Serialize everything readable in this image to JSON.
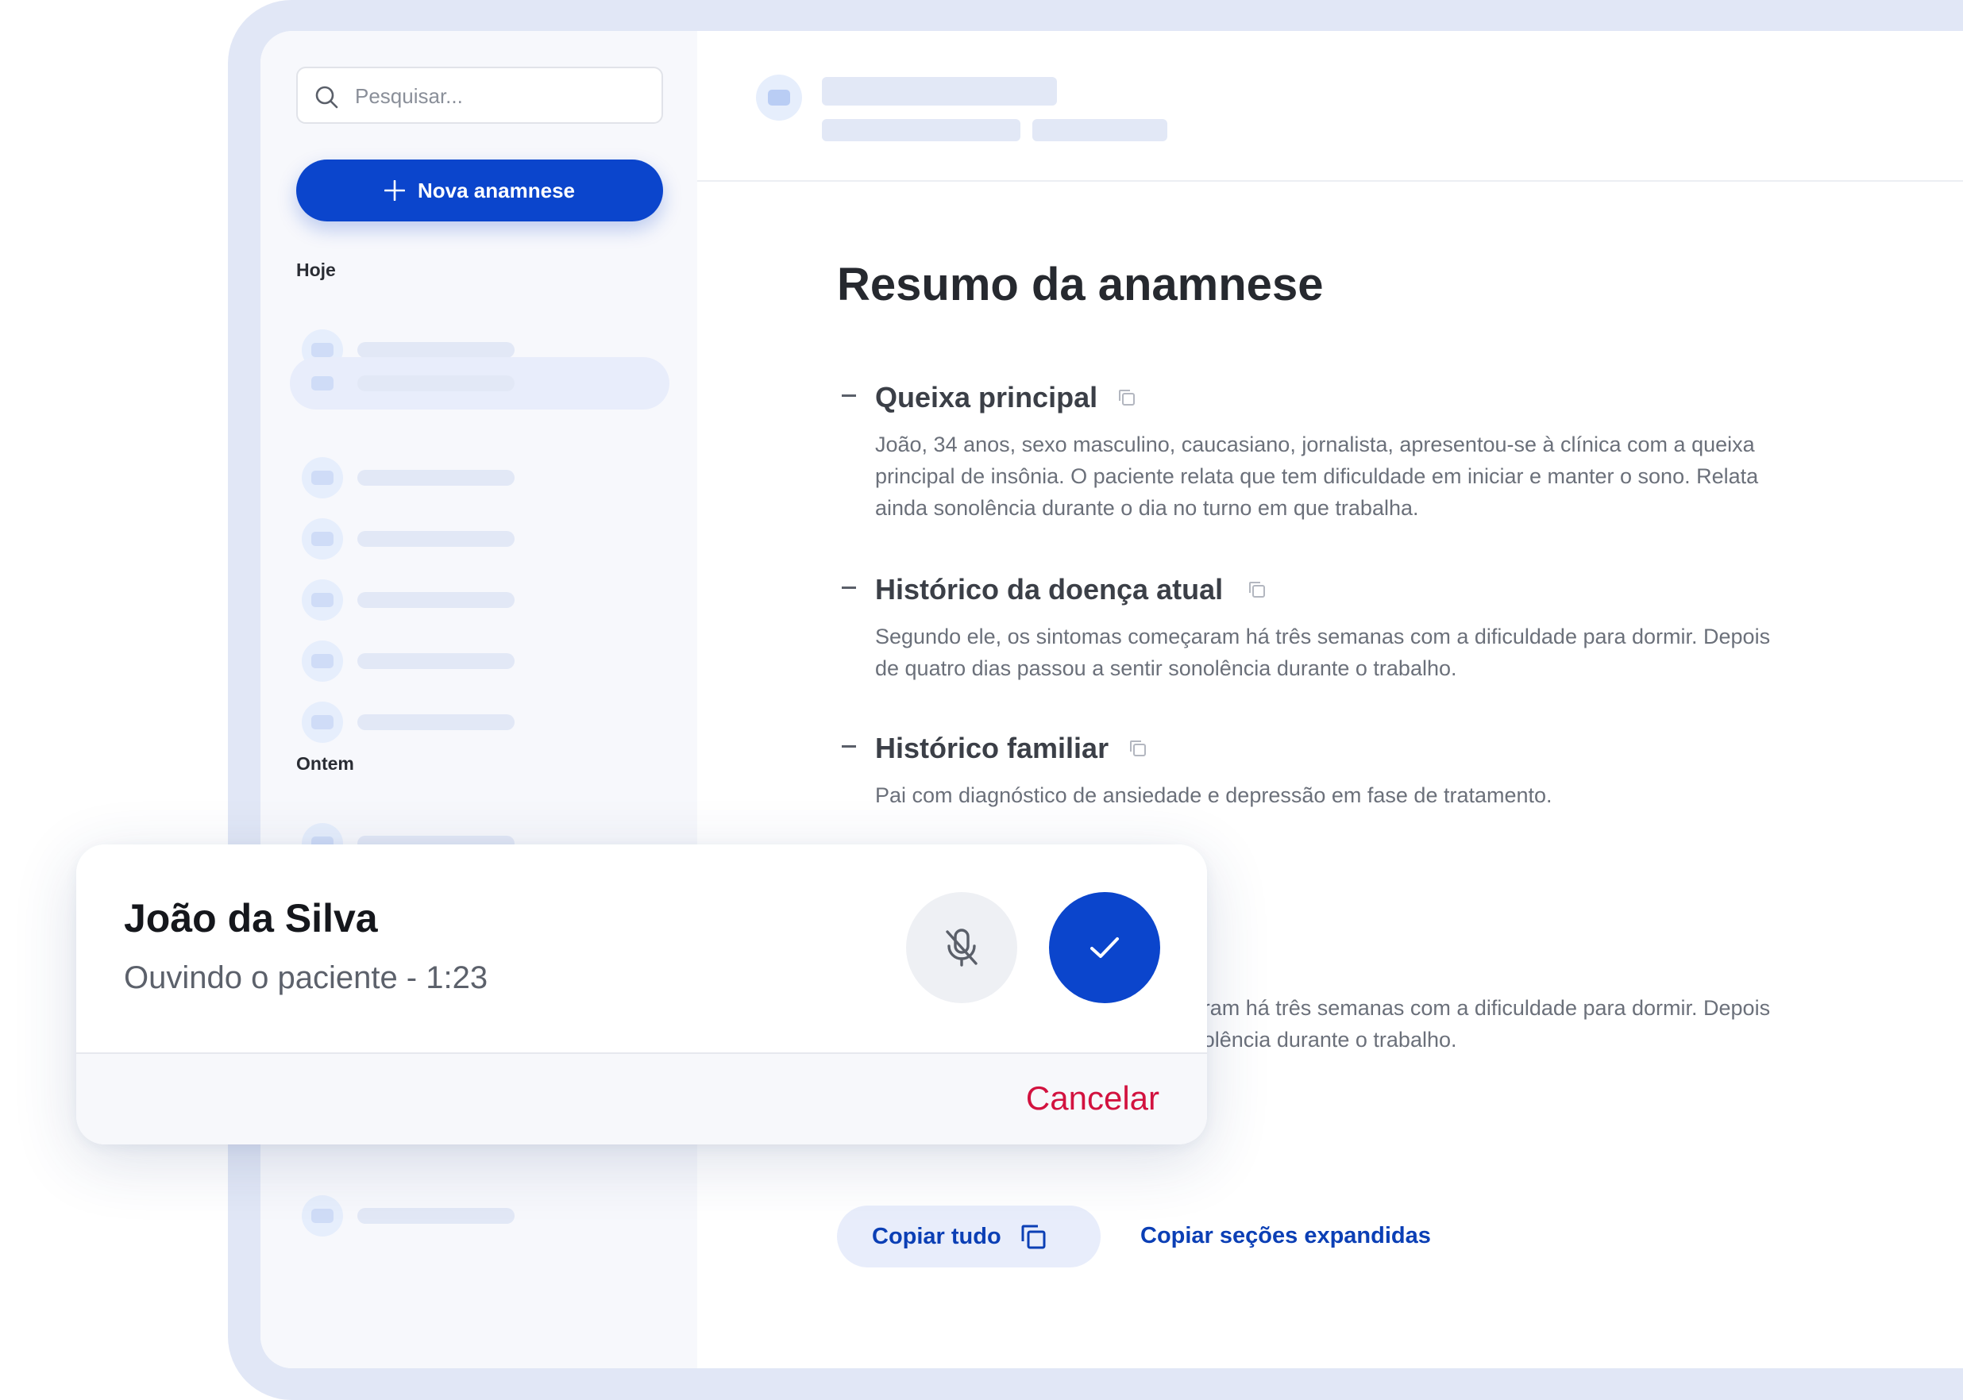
{
  "sidebar": {
    "search": {
      "placeholder": "Pesquisar..."
    },
    "new_button_label": "Nova anamnese",
    "groups": [
      {
        "label": "Hoje"
      },
      {
        "label": "Ontem"
      }
    ]
  },
  "main": {
    "title": "Resumo da anamnese",
    "sections": [
      {
        "heading": "Queixa principal",
        "body": "João, 34 anos, sexo masculino, caucasiano, jornalista, apresentou-se à clínica com a queixa principal de insônia. O paciente relata que tem dificuldade em iniciar e manter o sono. Relata ainda sonolência durante o dia no turno em que trabalha."
      },
      {
        "heading": "Histórico da doença atual",
        "body": "Segundo ele, os sintomas começaram há três semanas com a dificuldade para dormir. Depois de quatro dias passou a sentir sonolência durante o trabalho."
      },
      {
        "heading": "Histórico familiar",
        "body": "Pai com diagnóstico de ansiedade e depressão em fase de tratamento."
      },
      {
        "heading": "",
        "body": "Segundo ele, os sintomas começaram há três semanas com a dificuldade para dormir. Depois de quatro dias passou a sentir sonolência durante o trabalho."
      }
    ],
    "actions": {
      "copy_all_label": "Copiar tudo",
      "copy_expanded_label": "Copiar seções expandidas"
    }
  },
  "recording": {
    "patient_name": "João da Silva",
    "status": "Ouvindo o paciente - 1:23",
    "cancel_label": "Cancelar",
    "icons": {
      "mute": "mic-off-icon",
      "confirm": "check-icon"
    }
  },
  "colors": {
    "accent": "#0b45cc",
    "frame": "#e1e7f6",
    "danger": "#d2123f",
    "sidebar_bg": "#f7f8fc"
  }
}
